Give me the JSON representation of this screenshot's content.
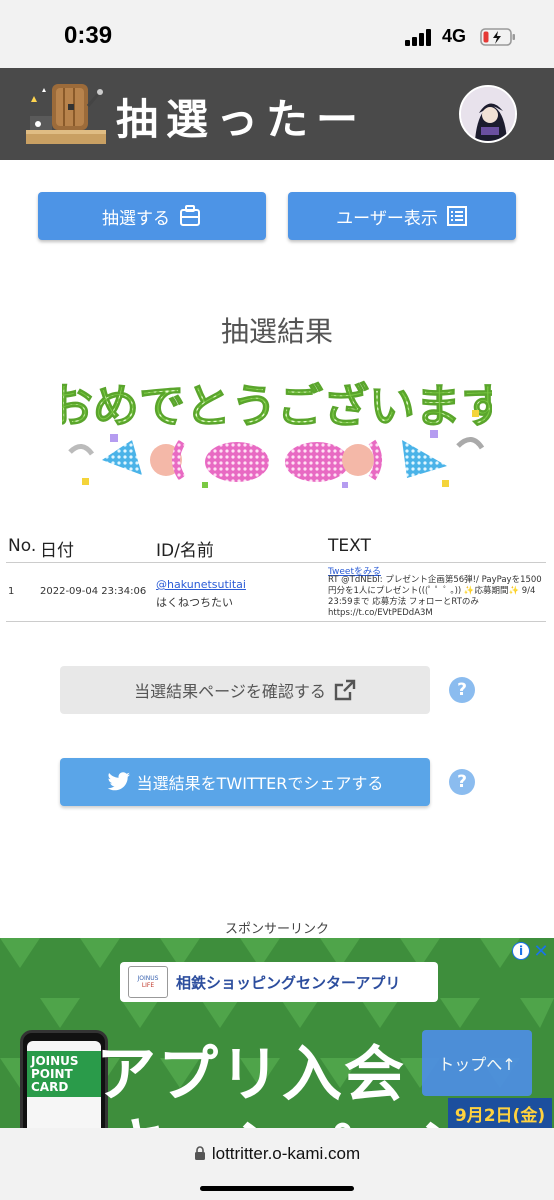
{
  "status_bar": {
    "time": "0:39",
    "network": "4G"
  },
  "header": {
    "title": "抽選ったー"
  },
  "nav": {
    "draw_label": "抽選する",
    "user_label": "ユーザー表示"
  },
  "result": {
    "title": "抽選結果",
    "banner_text": "おめでとうございます"
  },
  "table": {
    "headers": [
      "No.",
      "日付",
      "ID/名前",
      "TEXT"
    ],
    "rows": [
      {
        "no": "1",
        "date": "2022-09-04 23:34:06",
        "user_id": "@hakunetsutitai",
        "user_name": "はくねつちたい",
        "tweet_link": "Tweetをみる",
        "text": "RT @TdNEbl: プレゼント企画第56弾!/ PayPayを1500円分を1人にプレゼント(((ﾟ ゜ﾟ ｡)) ✨応募期間✨ 9/4 23:59まで 応募方法 フォローとRTのみ https://t.co/EVtPEDdA3M"
      }
    ]
  },
  "actions": {
    "confirm_label": "当選結果ページを確認する",
    "share_label": "当選結果をTWITTERでシェアする",
    "help_symbol": "?"
  },
  "sponsor": {
    "label": "スポンサーリンク"
  },
  "ad": {
    "brand_line1": "JOINUS",
    "brand_line2": "LIFE",
    "banner_text": "相鉄ショッピングセンターアプリ",
    "headline": "アプリ入会",
    "headline2": "キャンペーン",
    "phone_text": "JOINUS POINT CARD",
    "date_text": "9月2日(金)",
    "info_symbol": "i",
    "close_symbol": "✕"
  },
  "to_top": {
    "label": "トップへ↑"
  },
  "url_bar": {
    "url": "lottritter.o-kami.com"
  },
  "colors": {
    "header_bg": "#4a4a4a",
    "primary_button": "#4d94e6",
    "share_button": "#5aa5e8",
    "help_icon": "#8bbcef",
    "link": "#2b5cd6"
  }
}
